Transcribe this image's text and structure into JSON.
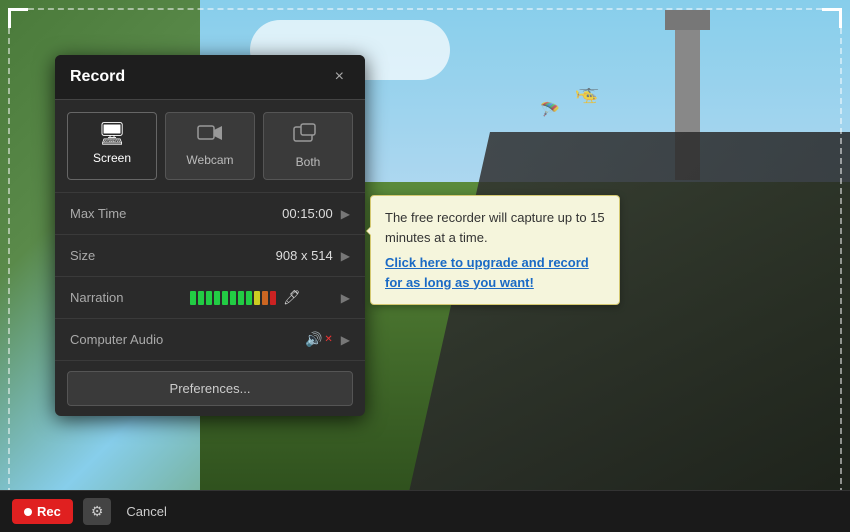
{
  "panel": {
    "title": "Record",
    "close_label": "×"
  },
  "sources": [
    {
      "id": "screen",
      "label": "Screen",
      "icon": "🖥",
      "active": true
    },
    {
      "id": "webcam",
      "label": "Webcam",
      "icon": "📷",
      "active": false
    },
    {
      "id": "both",
      "label": "Both",
      "icon": "📺",
      "active": false
    }
  ],
  "settings": {
    "max_time_label": "Max Time",
    "max_time_value": "00:15:00",
    "size_label": "Size",
    "size_value": "908 x 514",
    "narration_label": "Narration",
    "audio_label": "Computer Audio"
  },
  "preferences_label": "Preferences...",
  "tooltip": {
    "text": "The free recorder will capture up to 15 minutes at a time.",
    "link_text": "Click here to upgrade and record for as long as you want!"
  },
  "bottom_bar": {
    "rec_label": "Rec",
    "cancel_label": "Cancel"
  }
}
